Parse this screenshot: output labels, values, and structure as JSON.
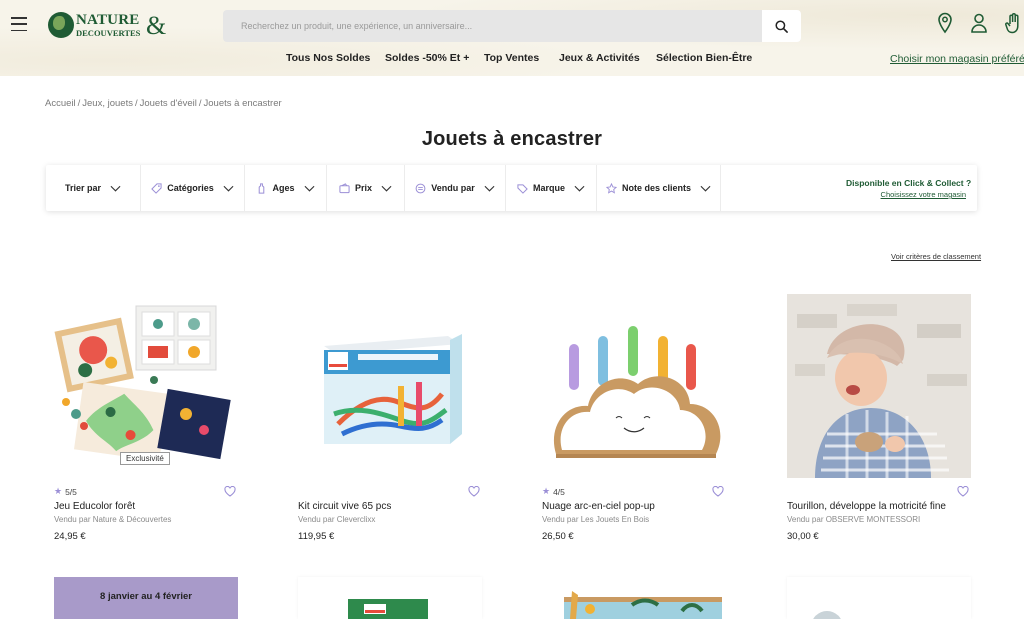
{
  "header": {
    "logo": {
      "line1": "NATURE",
      "line2": "DECOUVERTES",
      "ampersand": "&"
    },
    "search": {
      "placeholder": "Recherchez un produit, une expérience, un anniversaire..."
    },
    "nav": [
      {
        "label": "Tous Nos Soldes"
      },
      {
        "label": "Soldes -50% Et +"
      },
      {
        "label": "Top Ventes"
      },
      {
        "label": "Jeux & Activités"
      },
      {
        "label": "Sélection Bien-Être"
      }
    ],
    "store_link": "Choisir mon magasin préféré",
    "icons": [
      "location-pin-icon",
      "user-icon",
      "hand-icon"
    ]
  },
  "breadcrumb": [
    "Accueil",
    "Jeux, jouets",
    "Jouets d'éveil",
    "Jouets à encastrer"
  ],
  "breadcrumb_separator": "/",
  "page_title": "Jouets à encastrer",
  "filters": [
    {
      "label": "Trier par",
      "icon": ""
    },
    {
      "label": "Catégories",
      "icon": "tag-icon"
    },
    {
      "label": "Ages",
      "icon": "bottle-icon"
    },
    {
      "label": "Prix",
      "icon": "wallet-icon"
    },
    {
      "label": "Vendu par",
      "icon": "vendor-icon"
    },
    {
      "label": "Marque",
      "icon": "label-icon"
    },
    {
      "label": "Note des clients",
      "icon": "star-icon"
    }
  ],
  "click_collect": {
    "title": "Disponible en Click & Collect ?",
    "link": "Choisissez votre magasin"
  },
  "criteria_link": "Voir critères de classement",
  "products": [
    {
      "name": "Jeu Educolor forêt",
      "seller": "Vendu par Nature & Découvertes",
      "price": "24,95 €",
      "rating": "5/5",
      "badge": "Exclusivité"
    },
    {
      "name": "Kit circuit vive 65 pcs",
      "seller": "Vendu par Cleverclixx",
      "price": "119,95 €",
      "rating": "",
      "badge": ""
    },
    {
      "name": "Nuage arc-en-ciel pop-up",
      "seller": "Vendu par Les Jouets En Bois",
      "price": "26,50 €",
      "rating": "4/5",
      "badge": ""
    },
    {
      "name": "Tourillon, développe la motricité fine",
      "seller": "Vendu par OBSERVE MONTESSORI",
      "price": "30,00 €",
      "rating": "",
      "badge": ""
    }
  ],
  "next_row": [
    {
      "banner_text": "8 janvier au 4 février"
    }
  ],
  "colors": {
    "brand_green": "#1f5b34",
    "header_bg": "#f7f4ea",
    "accent_purple": "#9b8fd6"
  }
}
